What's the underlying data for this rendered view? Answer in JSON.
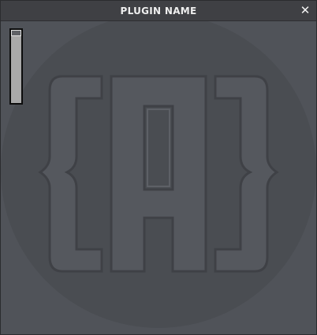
{
  "window": {
    "title": "PLUGIN NAME",
    "close_glyph": "✕",
    "close_icon": "close-icon"
  },
  "watermark": {
    "logo_text": "{A}",
    "icon": "brand-logo-watermark"
  },
  "slider": {
    "value_fraction": 1.0,
    "icon": "vertical-slider"
  },
  "colors": {
    "titlebar": "#3f4044",
    "background": "#505359",
    "watermark_circle": "#4a4d52",
    "slider_track": "#a9a9a9",
    "slider_thumb": "#5f6166"
  }
}
